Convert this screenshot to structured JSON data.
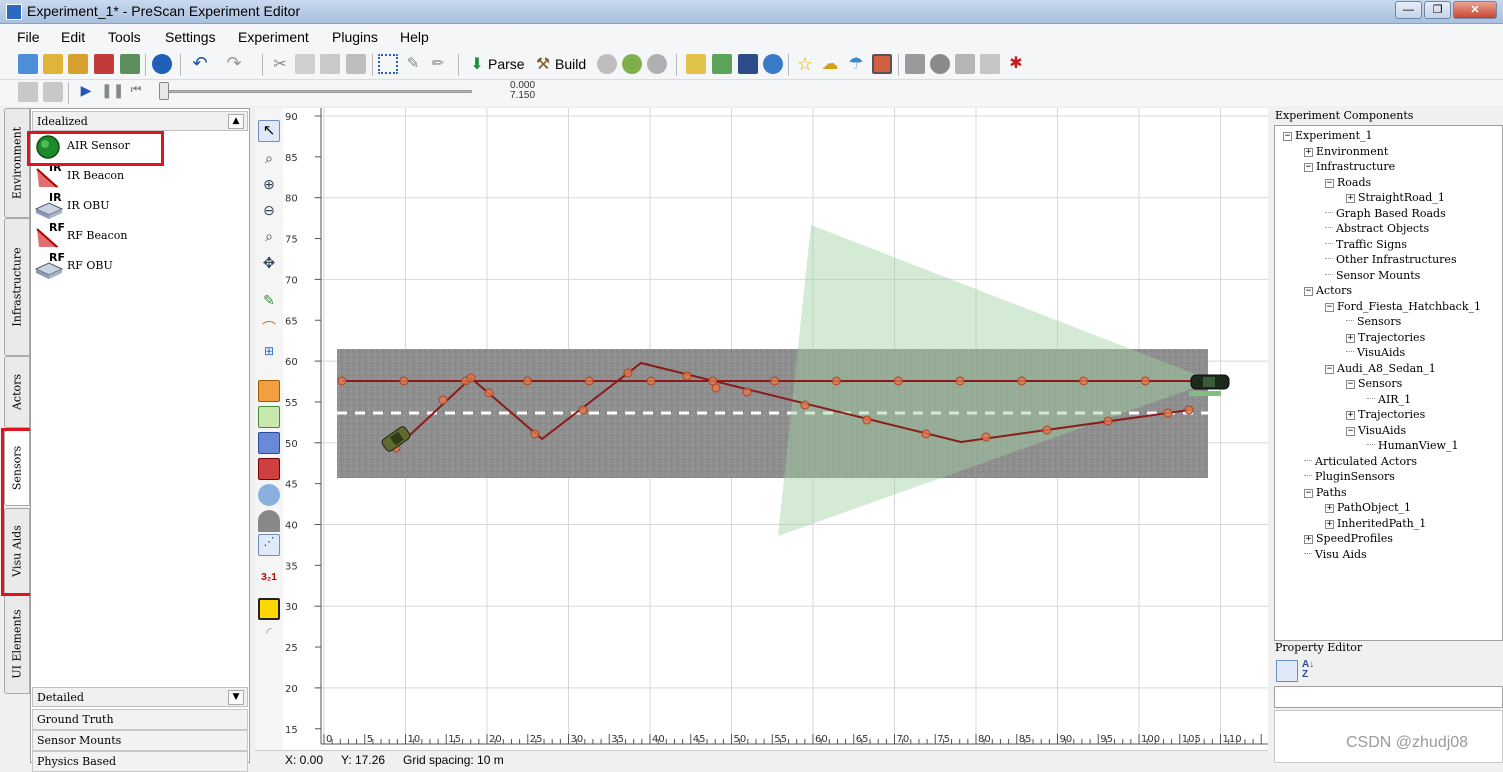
{
  "window": {
    "title": "Experiment_1* - PreScan Experiment Editor",
    "controls": [
      "—",
      "❐",
      "✕"
    ]
  },
  "menu": [
    "File",
    "Edit",
    "Tools",
    "Settings",
    "Experiment",
    "Plugins",
    "Help"
  ],
  "toolbar": {
    "parse_label": "Parse",
    "build_label": "Build"
  },
  "playback": {
    "time_current": "0.000",
    "time_total": "7.150"
  },
  "side_tabs": [
    "Environment",
    "Infrastructure",
    "Actors",
    "Sensors",
    "Visu Aids",
    "UI Elements"
  ],
  "active_side_tab": "Sensors",
  "palette": {
    "section_idealized": "Idealized",
    "items": [
      {
        "label": "AIR Sensor",
        "icon": "air-sensor-icon",
        "badge": ""
      },
      {
        "label": "IR Beacon",
        "icon": "ir-beacon-icon",
        "badge": "IR"
      },
      {
        "label": "IR OBU",
        "icon": "ir-obu-icon",
        "badge": "IR"
      },
      {
        "label": "RF Beacon",
        "icon": "rf-beacon-icon",
        "badge": "RF"
      },
      {
        "label": "RF OBU",
        "icon": "rf-obu-icon",
        "badge": "RF"
      }
    ],
    "section_detailed": "Detailed",
    "subsections": [
      "Ground Truth",
      "Sensor Mounts",
      "Physics Based"
    ]
  },
  "canvas": {
    "y_ticks": [
      "90",
      "85",
      "80",
      "75",
      "70",
      "65",
      "60",
      "55",
      "50",
      "45",
      "40",
      "35",
      "30",
      "25",
      "20",
      "15"
    ],
    "x_ticks": [
      "0",
      "5",
      "10",
      "15",
      "20",
      "25",
      "30",
      "35",
      "40",
      "45",
      "50",
      "55",
      "60",
      "65",
      "70",
      "75",
      "80",
      "85",
      "90",
      "95",
      "100",
      "105",
      "110"
    ],
    "colors": {
      "road": "#8e8e8e",
      "trajectory": "#8b1a1a",
      "sensor_cone": "#9fd09f",
      "grid": "#d8d8d8"
    }
  },
  "status": {
    "x": "X: 0.00",
    "y": "Y: 17.26",
    "grid": "Grid spacing: 10 m"
  },
  "components": {
    "title": "Experiment Components",
    "tree": [
      {
        "label": "Experiment_1",
        "depth": 0,
        "toggle": "minus"
      },
      {
        "label": "Environment",
        "depth": 1,
        "toggle": "plus"
      },
      {
        "label": "Infrastructure",
        "depth": 1,
        "toggle": "minus"
      },
      {
        "label": "Roads",
        "depth": 2,
        "toggle": "minus"
      },
      {
        "label": "StraightRoad_1",
        "depth": 3,
        "toggle": "plus"
      },
      {
        "label": "Graph Based Roads",
        "depth": 2,
        "toggle": "none"
      },
      {
        "label": "Abstract Objects",
        "depth": 2,
        "toggle": "none"
      },
      {
        "label": "Traffic Signs",
        "depth": 2,
        "toggle": "none"
      },
      {
        "label": "Other Infrastructures",
        "depth": 2,
        "toggle": "none"
      },
      {
        "label": "Sensor Mounts",
        "depth": 2,
        "toggle": "none"
      },
      {
        "label": "Actors",
        "depth": 1,
        "toggle": "minus"
      },
      {
        "label": "Ford_Fiesta_Hatchback_1",
        "depth": 2,
        "toggle": "minus"
      },
      {
        "label": "Sensors",
        "depth": 3,
        "toggle": "none"
      },
      {
        "label": "Trajectories",
        "depth": 3,
        "toggle": "plus"
      },
      {
        "label": "VisuAids",
        "depth": 3,
        "toggle": "none"
      },
      {
        "label": "Audi_A8_Sedan_1",
        "depth": 2,
        "toggle": "minus"
      },
      {
        "label": "Sensors",
        "depth": 3,
        "toggle": "minus"
      },
      {
        "label": "AIR_1",
        "depth": 4,
        "toggle": "none"
      },
      {
        "label": "Trajectories",
        "depth": 3,
        "toggle": "plus"
      },
      {
        "label": "VisuAids",
        "depth": 3,
        "toggle": "minus"
      },
      {
        "label": "HumanView_1",
        "depth": 4,
        "toggle": "none"
      },
      {
        "label": "Articulated Actors",
        "depth": 1,
        "toggle": "none"
      },
      {
        "label": "PluginSensors",
        "depth": 1,
        "toggle": "none"
      },
      {
        "label": "Paths",
        "depth": 1,
        "toggle": "minus"
      },
      {
        "label": "PathObject_1",
        "depth": 2,
        "toggle": "plus"
      },
      {
        "label": "InheritedPath_1",
        "depth": 2,
        "toggle": "plus"
      },
      {
        "label": "SpeedProfiles",
        "depth": 1,
        "toggle": "plus"
      },
      {
        "label": "Visu Aids",
        "depth": 1,
        "toggle": "none"
      }
    ]
  },
  "property_editor": {
    "title": "Property Editor"
  },
  "watermark": "CSDN @zhudj08"
}
